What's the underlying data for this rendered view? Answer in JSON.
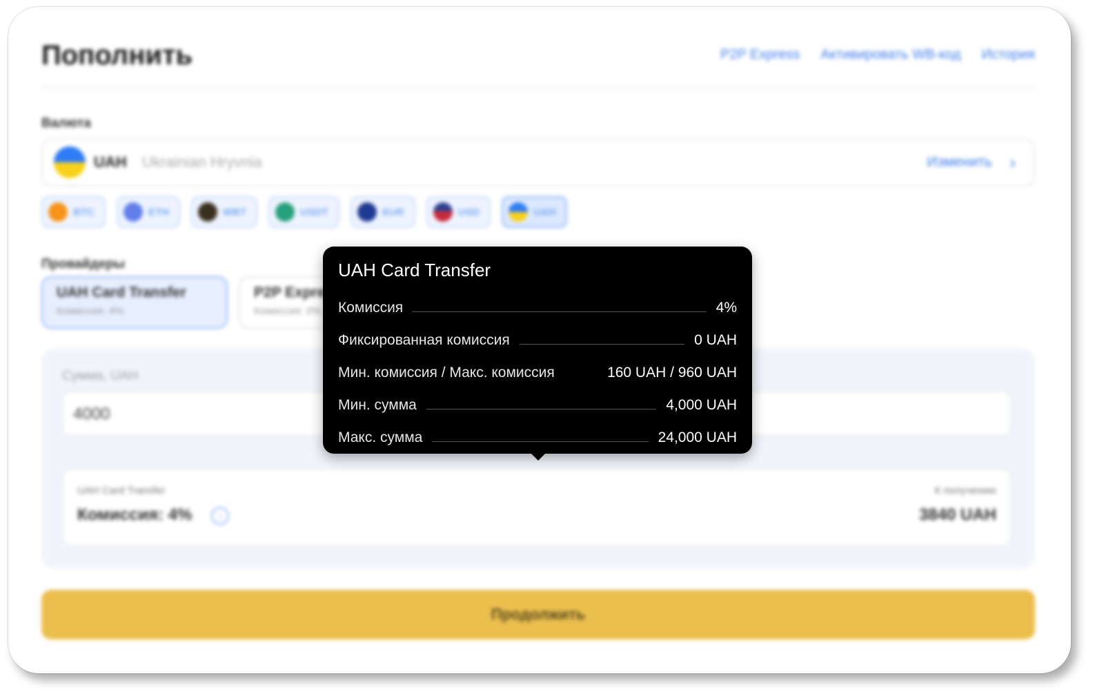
{
  "header": {
    "title": "Пополнить",
    "links": [
      "P2P Express",
      "Активировать WB-код",
      "История"
    ]
  },
  "currency": {
    "label": "Валюта",
    "code": "UAH",
    "name": "Ukrainian Hryvnia",
    "change_label": "Изменить"
  },
  "chips": [
    {
      "label": "BTC",
      "color": "#f7931a",
      "icon": "bitcoin-icon"
    },
    {
      "label": "ETH",
      "color": "#627eea",
      "icon": "ethereum-icon"
    },
    {
      "label": "WBT",
      "color": "#3a3020",
      "icon": "wbt-icon"
    },
    {
      "label": "USDT",
      "color": "#26a17b",
      "icon": "tether-icon"
    },
    {
      "label": "EUR",
      "color": "#1f3a93",
      "icon": "eu-flag-icon"
    },
    {
      "label": "USD",
      "color": "#c62a3a",
      "icon": "us-flag-icon"
    },
    {
      "label": "UAH",
      "color": "#2e7cf6",
      "icon": "ua-flag-icon",
      "active": true
    }
  ],
  "providers": {
    "label": "Провайдеры",
    "items": [
      {
        "name": "UAH Card Transfer",
        "commission": "Комиссия: 4%"
      },
      {
        "name": "P2P Express",
        "commission": "Комиссия: 0%"
      }
    ]
  },
  "amount": {
    "label": "Сумма, UAH",
    "value": "4000"
  },
  "summary": {
    "provider": "UAH Card Transfer",
    "commission": "Комиссия: 4%",
    "receive_label": "К получению",
    "receive_value": "3840 UAH"
  },
  "continue_label": "Продолжить",
  "tooltip": {
    "title": "UAH Card Transfer",
    "rows": [
      {
        "key": "Комиссия",
        "value": "4%"
      },
      {
        "key": "Фиксированная комиссия",
        "value": "0 UAH"
      },
      {
        "key": "Мин. комиссия / Макс. комиссия",
        "value": "160 UAH / 960 UAH"
      },
      {
        "key": "Мин. сумма",
        "value": "4,000 UAH"
      },
      {
        "key": "Макс. сумма",
        "value": "24,000 UAH"
      }
    ]
  }
}
